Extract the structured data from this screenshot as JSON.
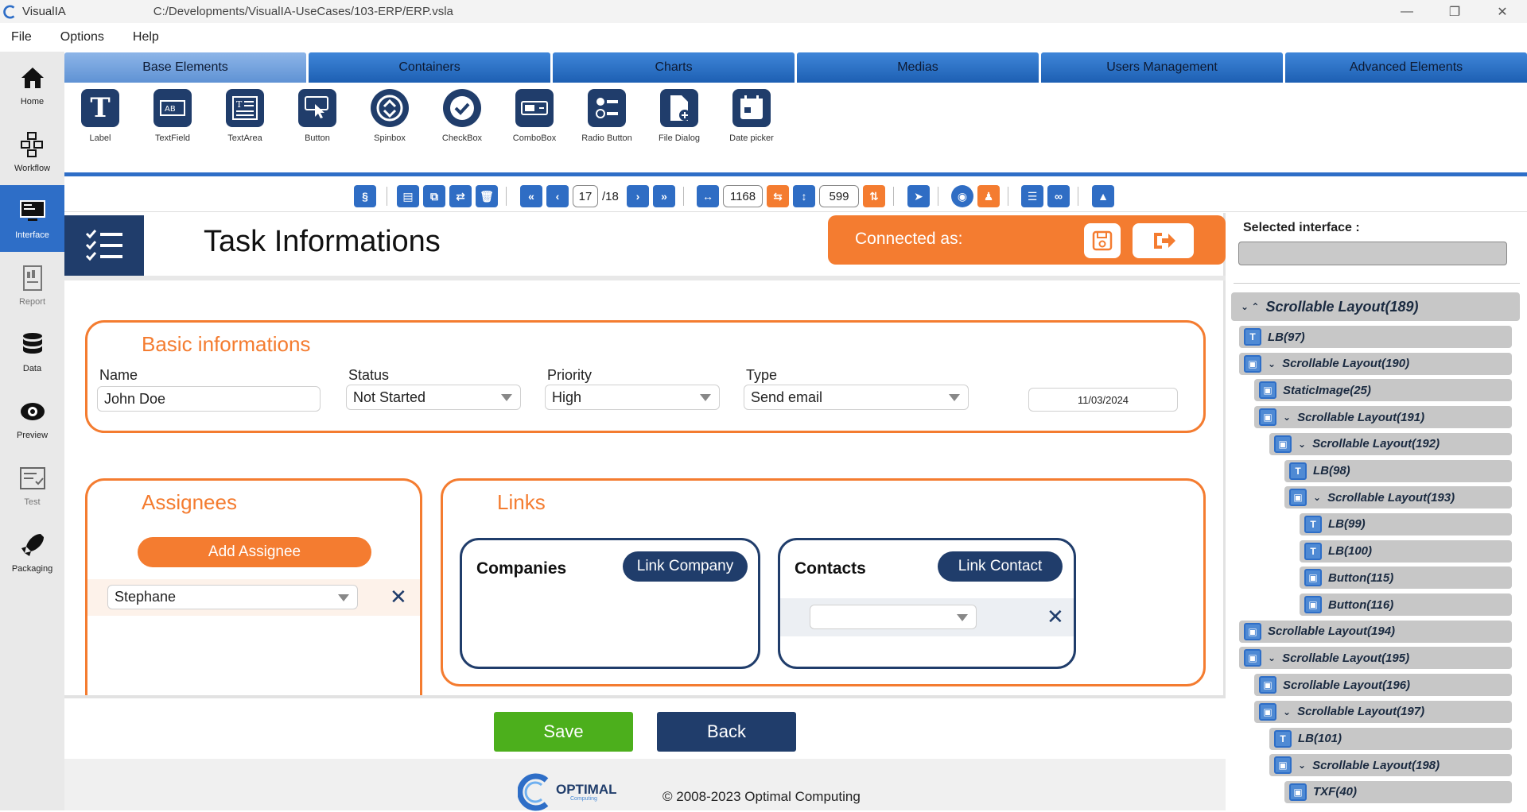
{
  "titlebar": {
    "app_name": "VisualIA",
    "path": "C:/Developments/VisualIA-UseCases/103-ERP/ERP.vsla"
  },
  "menu": [
    "File",
    "Options",
    "Help"
  ],
  "sidebar": [
    {
      "label": "Home",
      "icon": "home-icon"
    },
    {
      "label": "Workflow",
      "icon": "workflow-icon"
    },
    {
      "label": "Interface",
      "icon": "interface-icon"
    },
    {
      "label": "Report",
      "icon": "report-icon"
    },
    {
      "label": "Data",
      "icon": "data-icon"
    },
    {
      "label": "Preview",
      "icon": "preview-icon"
    },
    {
      "label": "Test",
      "icon": "test-icon"
    },
    {
      "label": "Packaging",
      "icon": "packaging-icon"
    }
  ],
  "tabs": [
    "Base Elements",
    "Containers",
    "Charts",
    "Medias",
    "Users Management",
    "Advanced Elements"
  ],
  "palette": [
    "Label",
    "TextField",
    "TextArea",
    "Button",
    "Spinbox",
    "CheckBox",
    "ComboBox",
    "Radio Button",
    "File Dialog",
    "Date picker"
  ],
  "toolbar": {
    "page_current": "17",
    "page_total": "/18",
    "width": "1168",
    "height": "599"
  },
  "canvas": {
    "title": "Task Informations",
    "connected_label": "Connected as:",
    "basic": {
      "title": "Basic informations",
      "name_label": "Name",
      "name_value": "John Doe",
      "status_label": "Status",
      "status_value": "Not Started",
      "priority_label": "Priority",
      "priority_value": "High",
      "type_label": "Type",
      "type_value": "Send email",
      "date_value": "11/03/2024"
    },
    "assignees": {
      "title": "Assignees",
      "add_label": "Add Assignee",
      "item": "Stephane"
    },
    "links": {
      "title": "Links",
      "companies_title": "Companies",
      "link_company": "Link Company",
      "contacts_title": "Contacts",
      "link_contact": "Link Contact"
    },
    "save_label": "Save",
    "back_label": "Back",
    "brand": "OPTIMAL",
    "brand_sub": "Computing",
    "copyright": "© 2008-2023 Optimal Computing"
  },
  "right": {
    "selected_label": "Selected interface :",
    "tree": [
      {
        "label": "Scrollable Layout(189)",
        "depth": 0,
        "chev": "⌄ ⌃",
        "kind": "root"
      },
      {
        "label": "LB(97)",
        "depth": 1,
        "chev": ""
      },
      {
        "label": "Scrollable Layout(190)",
        "depth": 1,
        "chev": "⌄"
      },
      {
        "label": "StaticImage(25)",
        "depth": 2,
        "chev": ""
      },
      {
        "label": "Scrollable Layout(191)",
        "depth": 2,
        "chev": "⌄"
      },
      {
        "label": "Scrollable Layout(192)",
        "depth": 3,
        "chev": "⌄"
      },
      {
        "label": "LB(98)",
        "depth": 4,
        "chev": ""
      },
      {
        "label": "Scrollable Layout(193)",
        "depth": 4,
        "chev": "⌄"
      },
      {
        "label": "LB(99)",
        "depth": 5,
        "chev": ""
      },
      {
        "label": "LB(100)",
        "depth": 5,
        "chev": ""
      },
      {
        "label": "Button(115)",
        "depth": 5,
        "chev": ""
      },
      {
        "label": "Button(116)",
        "depth": 5,
        "chev": ""
      },
      {
        "label": "Scrollable Layout(194)",
        "depth": 1,
        "chev": ""
      },
      {
        "label": "Scrollable Layout(195)",
        "depth": 1,
        "chev": "⌄"
      },
      {
        "label": "Scrollable Layout(196)",
        "depth": 2,
        "chev": ""
      },
      {
        "label": "Scrollable Layout(197)",
        "depth": 2,
        "chev": "⌄"
      },
      {
        "label": "LB(101)",
        "depth": 3,
        "chev": ""
      },
      {
        "label": "Scrollable Layout(198)",
        "depth": 3,
        "chev": "⌄"
      },
      {
        "label": "TXF(40)",
        "depth": 4,
        "chev": ""
      }
    ]
  }
}
